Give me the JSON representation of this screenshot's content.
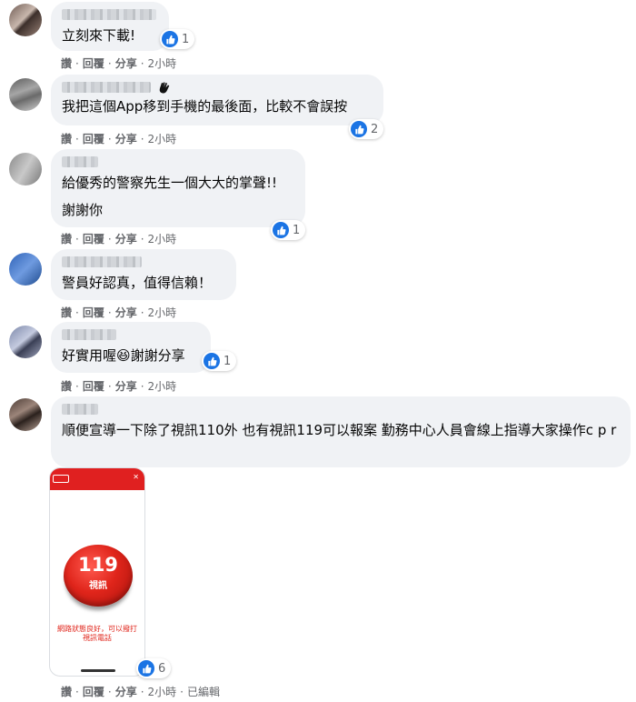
{
  "actions": {
    "like": "讚",
    "reply": "回覆",
    "share": "分享",
    "dot": "·",
    "edited": "已編輯"
  },
  "comments": [
    {
      "text": "立刻來下載!",
      "time": "2小時",
      "reactions": "1"
    },
    {
      "text": "我把這個App移到手機的最後面，比較不會誤按",
      "time": "2小時",
      "reactions": "2"
    },
    {
      "text_line1": "給優秀的警察先生一個大大的掌聲!!",
      "text_line2": "謝謝你",
      "time": "2小時",
      "reactions": "1"
    },
    {
      "text": "警員好認真，值得信賴！",
      "time": "2小時"
    },
    {
      "text_a": "好實用喔",
      "text_b": "謝謝分享",
      "emoji": "😆",
      "time": "2小時",
      "reactions": "1"
    },
    {
      "text": "順便宣導一下除了視訊110外 也有視訊119可以報案 勤務中心人員會線上指導大家操作c p r",
      "time": "2小時",
      "reactions": "6",
      "attachment": {
        "button_number": "119",
        "button_label": "視訊",
        "note": "網路狀態良好，可以撥打視訊電話"
      }
    }
  ],
  "icons": {
    "like": "thumbs-up-icon",
    "wave": "waving-hand-icon"
  },
  "colors": {
    "like_blue": "#1b74e4",
    "bubble": "#f0f2f5",
    "meta_gray": "#65676b",
    "app_red": "#e02020"
  }
}
